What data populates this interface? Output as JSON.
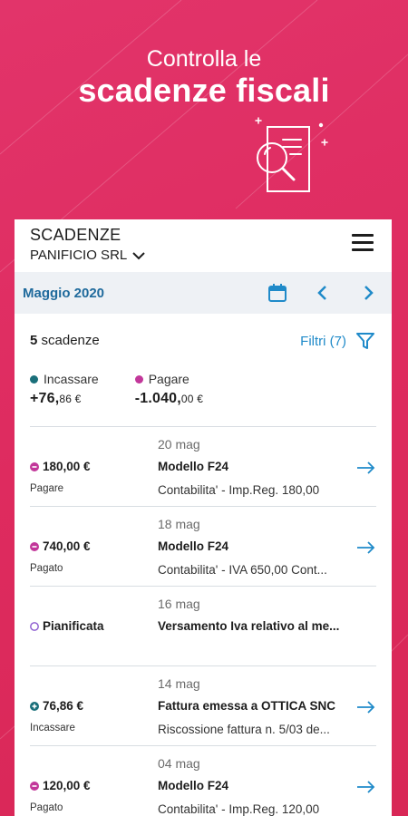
{
  "hero": {
    "subtitle": "Controlla le",
    "title": "scadenze fiscali"
  },
  "header": {
    "title": "SCADENZE",
    "company": "PANIFICIO SRL"
  },
  "calendar": {
    "month": "Maggio 2020"
  },
  "summary": {
    "count_number": "5",
    "count_label": "scadenze",
    "filters_label": "Filtri (7)"
  },
  "totals": {
    "incassare": {
      "label": "Incassare",
      "value_main": "+76,",
      "value_dec": "86 €",
      "color": "#1a6f7a"
    },
    "pagare": {
      "label": "Pagare",
      "value_main": "-1.040,",
      "value_dec": "00 €",
      "color": "#c2379a"
    }
  },
  "rows": [
    {
      "date": "20 mag",
      "amount": "180,00 €",
      "status": "Pagare",
      "title": "Modello F24",
      "desc": "Contabilita' - Imp.Reg. 180,00",
      "icon": "minus-icon",
      "icon_color": "#c2379a"
    },
    {
      "date": "18 mag",
      "amount": "740,00 €",
      "status": "Pagato",
      "title": "Modello F24",
      "desc": "Contabilita' - IVA 650,00 Cont...",
      "icon": "minus-icon",
      "icon_color": "#c2379a"
    },
    {
      "date": "16 mag",
      "amount": "Pianificata",
      "status": "",
      "title": "Versamento Iva relativo al me...",
      "desc": "",
      "icon": "circle-outline-icon",
      "icon_color": "#8c5bd0"
    },
    {
      "date": "14 mag",
      "amount": "76,86 €",
      "status": "Incassare",
      "title": "Fattura emessa a OTTICA SNC",
      "desc": "Riscossione fattura n. 5/03 de...",
      "icon": "plus-icon",
      "icon_color": "#1a6f7a"
    },
    {
      "date": "04 mag",
      "amount": "120,00 €",
      "status": "Pagato",
      "title": "Modello F24",
      "desc": "Contabilita' - Imp.Reg. 120,00",
      "icon": "minus-icon",
      "icon_color": "#c2379a"
    }
  ],
  "colors": {
    "accent_blue": "#1f8ac9",
    "month_blue": "#1f6a9c",
    "background_pink": "#de2b5f"
  }
}
